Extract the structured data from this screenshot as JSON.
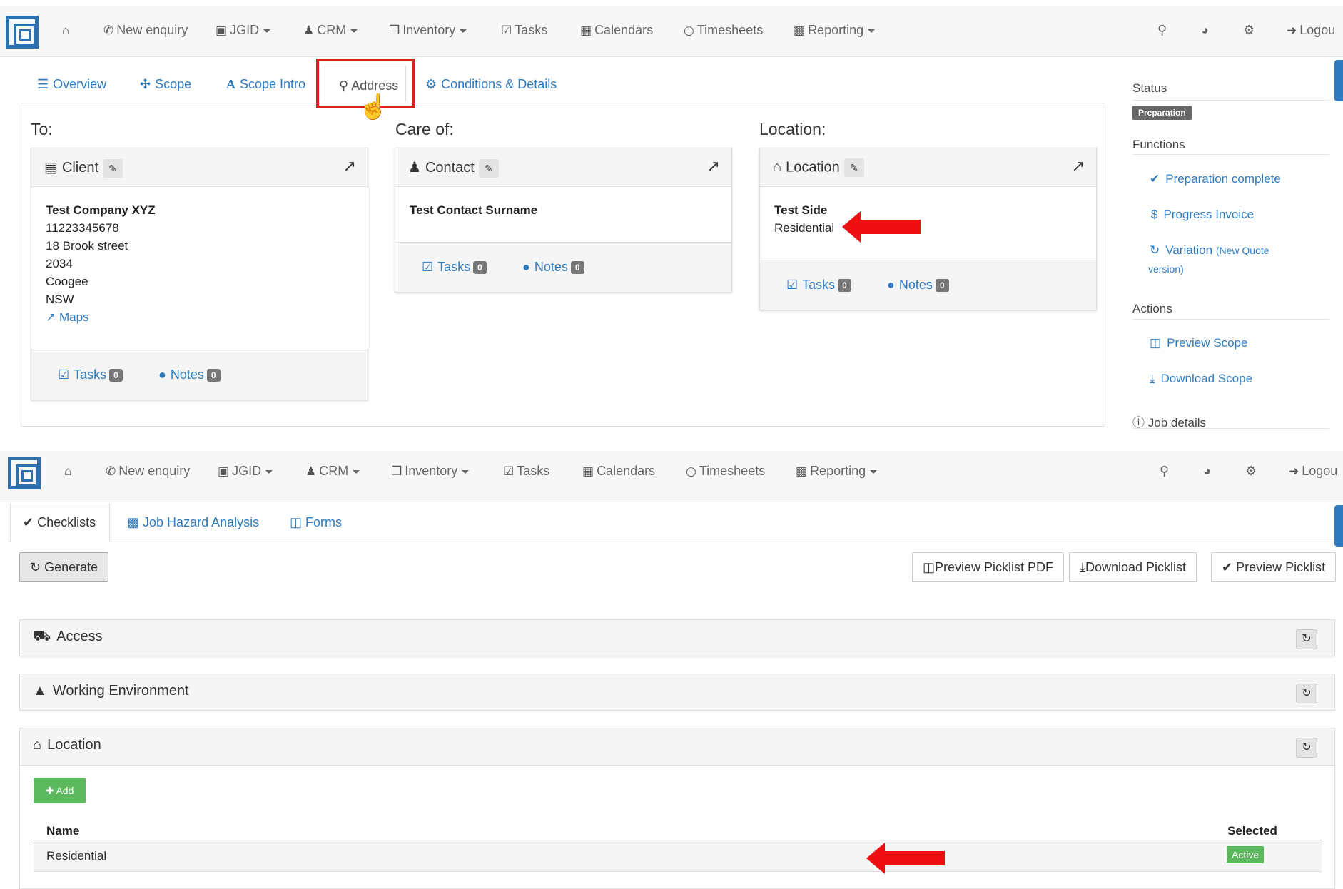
{
  "navbar": {
    "items": [
      {
        "label": "New enquiry",
        "icon": "phone-icon"
      },
      {
        "label": "JGID",
        "icon": "card-icon"
      },
      {
        "label": "CRM",
        "icon": "users-icon"
      },
      {
        "label": "Inventory",
        "icon": "cubes-icon"
      },
      {
        "label": "Tasks",
        "icon": "check-square-icon"
      },
      {
        "label": "Calendars",
        "icon": "calendar-icon"
      },
      {
        "label": "Timesheets",
        "icon": "clock-icon"
      },
      {
        "label": "Reporting",
        "icon": "bar-chart-icon"
      }
    ],
    "logout": "Logou"
  },
  "top": {
    "tabs": [
      "Overview",
      "Scope",
      "Scope Intro",
      "Address",
      "Conditions & Details"
    ],
    "to_title": "To:",
    "care_title": "Care of:",
    "location_title": "Location:",
    "client_card": {
      "title": "Client",
      "name": "Test Company XYZ",
      "lines": [
        "11223345678",
        "18 Brook street",
        "2034",
        "Coogee",
        "NSW"
      ],
      "maps": "Maps",
      "tasks": "Tasks",
      "tasks_count": "0",
      "notes": "Notes",
      "notes_count": "0"
    },
    "contact_card": {
      "title": "Contact",
      "name": "Test Contact Surname",
      "tasks": "Tasks",
      "tasks_count": "0",
      "notes": "Notes",
      "notes_count": "0"
    },
    "location_card": {
      "title": "Location",
      "name": "Test Side",
      "type": "Residential",
      "tasks": "Tasks",
      "tasks_count": "0",
      "notes": "Notes",
      "notes_count": "0"
    },
    "sidebar": {
      "status_h": "Status",
      "status": "Preparation",
      "functions_h": "Functions",
      "prep_complete": "Preparation complete",
      "progress_invoice": "Progress Invoice",
      "variation": "Variation",
      "variation_note1": "(New Quote",
      "variation_note2": "version)",
      "actions_h": "Actions",
      "preview_scope": "Preview Scope",
      "download_scope": "Download Scope",
      "job_details": "Job details"
    }
  },
  "bottom": {
    "tabs": [
      "Checklists",
      "Job Hazard Analysis",
      "Forms"
    ],
    "generate": "Generate",
    "preview_pdf": "Preview Picklist PDF",
    "download_picklist": "Download Picklist",
    "preview_picklist": "Preview Picklist",
    "sections": [
      "Access",
      "Working Environment",
      "Location"
    ],
    "add": "Add",
    "col_name": "Name",
    "col_selected": "Selected",
    "row_name": "Residential",
    "row_status": "Active"
  },
  "colors": {
    "accent": "#2f7bc0",
    "highlight": "#e01d23",
    "success": "#5cb85c"
  }
}
